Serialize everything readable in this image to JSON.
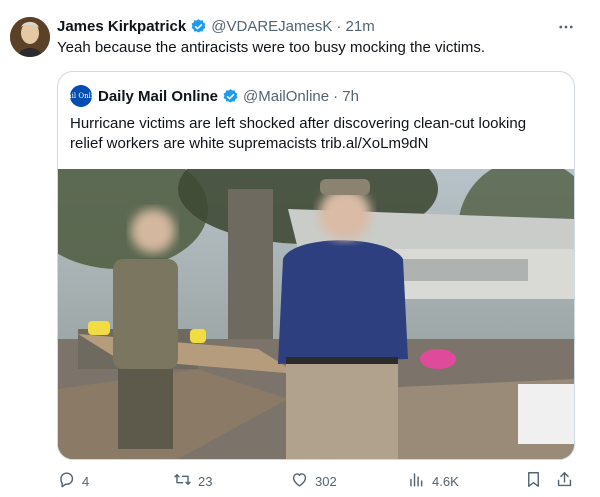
{
  "author": {
    "name": "James Kirkpatrick",
    "handle": "@VDAREJamesK",
    "time": "· 21m",
    "avatar": "avatar"
  },
  "tweet_text": "Yeah because the antiracists were too busy mocking the victims.",
  "quote": {
    "name": "Daily Mail Online",
    "handle": "@MailOnline",
    "time": "· 7h",
    "logo_text": "Mail Online",
    "text": "Hurricane victims are left shocked after discovering clean-cut looking relief workers are white supremacists trib.al/XoLm9dN",
    "media_icon": "photo"
  },
  "actions": {
    "reply_count": "4",
    "retweet_count": "23",
    "like_count": "302",
    "views_count": "4.6K"
  },
  "icons": {
    "verified": "verified-badge-icon",
    "more": "more-icon",
    "reply": "reply-icon",
    "retweet": "retweet-icon",
    "like": "like-icon",
    "views": "views-icon",
    "bookmark": "bookmark-icon",
    "share": "share-icon"
  },
  "colors": {
    "verified": "#1d9bf0",
    "muted": "#536471",
    "border": "#cfd9de",
    "mail_blue": "#004db3"
  }
}
